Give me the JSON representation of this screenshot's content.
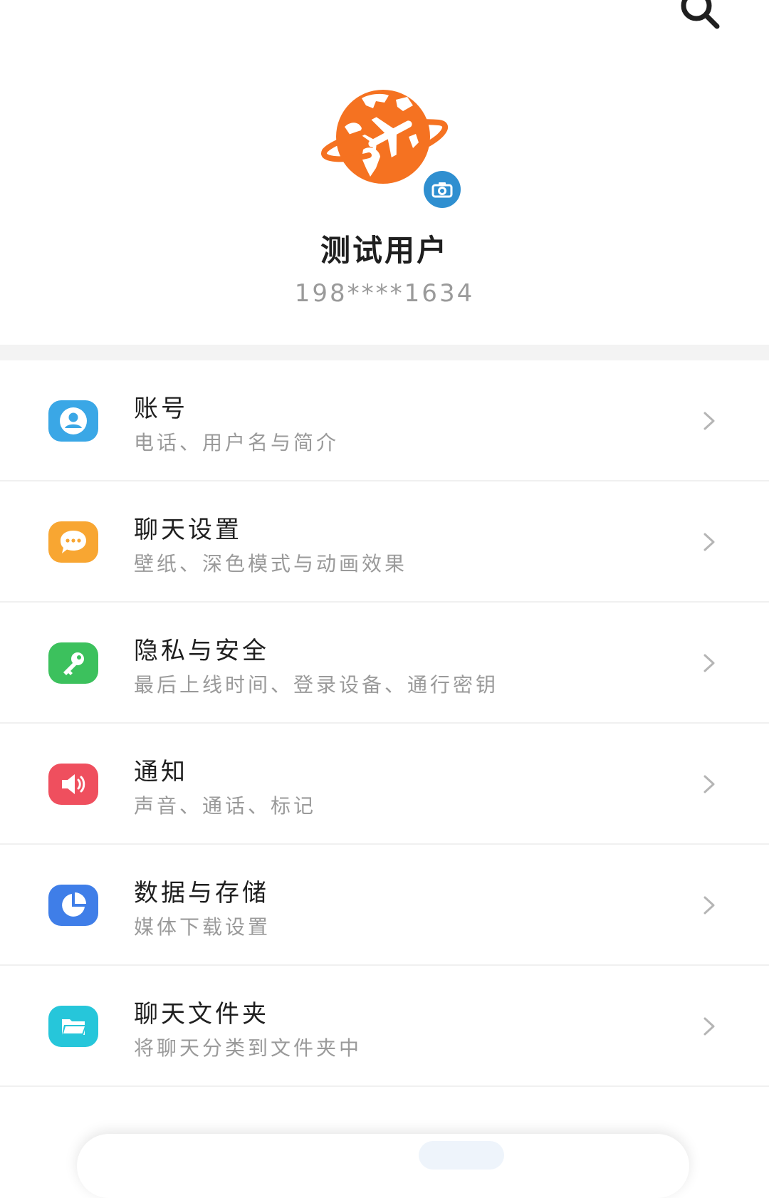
{
  "header": {
    "search_icon": "search-icon"
  },
  "profile": {
    "name": "测试用户",
    "phone": "198****1634",
    "avatar_icon": "globe-airplane-avatar",
    "camera_icon": "camera-icon",
    "avatar_color": "#f57221",
    "camera_badge_color": "#2f8fd0"
  },
  "settings": {
    "items": [
      {
        "title": "账号",
        "subtitle": "电话、用户名与简介",
        "icon": "account-icon",
        "color": "#3aa7e6"
      },
      {
        "title": "聊天设置",
        "subtitle": "壁纸、深色模式与动画效果",
        "icon": "chat-bubble-icon",
        "color": "#f8a632"
      },
      {
        "title": "隐私与安全",
        "subtitle": "最后上线时间、登录设备、通行密钥",
        "icon": "key-icon",
        "color": "#3cc15d"
      },
      {
        "title": "通知",
        "subtitle": "声音、通话、标记",
        "icon": "speaker-icon",
        "color": "#ef4f5e"
      },
      {
        "title": "数据与存储",
        "subtitle": "媒体下载设置",
        "icon": "pie-chart-icon",
        "color": "#3f7ee8"
      },
      {
        "title": "聊天文件夹",
        "subtitle": "将聊天分类到文件夹中",
        "icon": "folder-icon",
        "color": "#26c6da"
      }
    ]
  }
}
